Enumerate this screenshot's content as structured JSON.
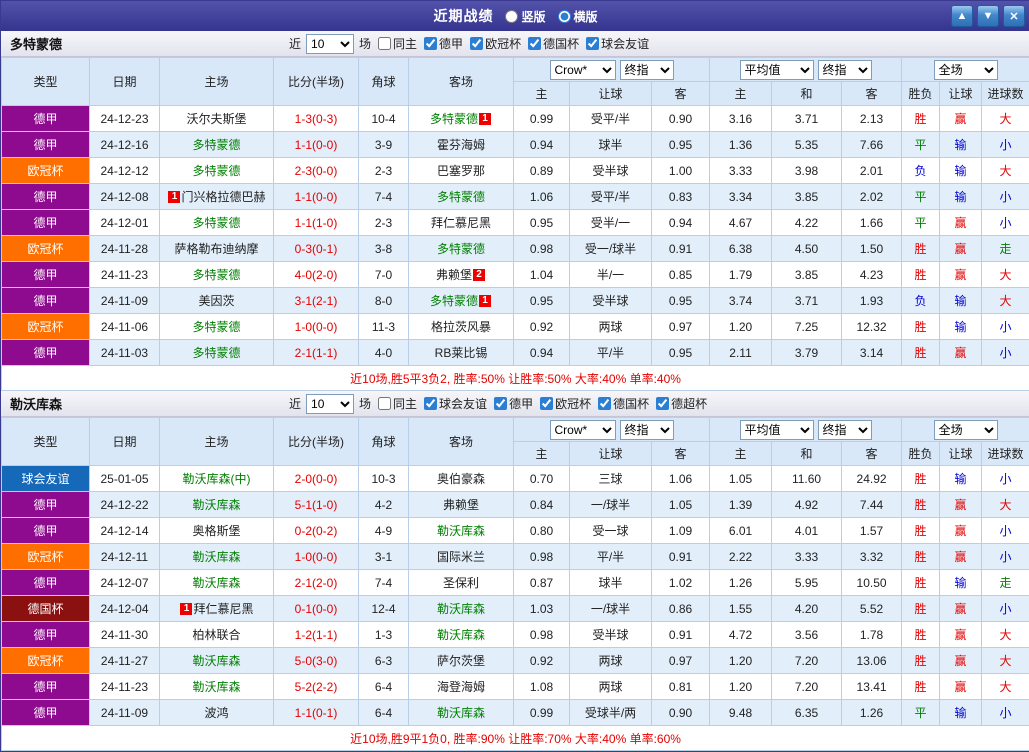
{
  "titlebar": {
    "title": "近期战绩",
    "radio_vertical": "竖版",
    "radio_horizontal": "横版",
    "vertical_selected": false,
    "horizontal_selected": true,
    "up_icon": "▲",
    "down_icon": "▼",
    "close_icon": "✕"
  },
  "colors": {
    "league": {
      "德甲": "#8e0a8e",
      "欧冠杯": "#ff6f00",
      "德国杯": "#8b1010",
      "球会友谊": "#1569b8"
    },
    "win": "#e60000",
    "draw": "#008000",
    "loss": "#0000d8",
    "team_highlight": "#008000"
  },
  "table_header": {
    "cols": [
      "类型",
      "日期",
      "主场",
      "比分(半场)",
      "角球",
      "客场"
    ],
    "sub_cols": [
      "主",
      "让球",
      "客",
      "主",
      "和",
      "客",
      "胜负",
      "让球",
      "进球数"
    ],
    "bookmaker_select": "Crow*",
    "final_index_select_1": "终指",
    "average_select": "平均值",
    "final_index_select_2": "终指",
    "scope_select": "全场"
  },
  "sections": [
    {
      "team": "多特蒙德",
      "filter": {
        "prefix": "近",
        "count": "10",
        "suffix": "场",
        "checkboxes": [
          {
            "label": "同主",
            "checked": false
          },
          {
            "label": "德甲",
            "checked": true
          },
          {
            "label": "欧冠杯",
            "checked": true
          },
          {
            "label": "德国杯",
            "checked": true
          },
          {
            "label": "球会友谊",
            "checked": true
          }
        ]
      },
      "rows": [
        {
          "league": "德甲",
          "date": "24-12-23",
          "home": {
            "name": "沃尔夫斯堡"
          },
          "score": "1-3(0-3)",
          "corner": "10-4",
          "away": {
            "name": "多特蒙德",
            "hl": true,
            "badge": "1",
            "pos": "after"
          },
          "odds": [
            "0.99",
            "受平/半",
            "0.90"
          ],
          "avg": [
            "3.16",
            "3.71",
            "2.13"
          ],
          "res": [
            [
              "胜",
              "r"
            ],
            [
              "赢",
              "r"
            ],
            [
              "大",
              "r"
            ]
          ]
        },
        {
          "league": "德甲",
          "date": "24-12-16",
          "home": {
            "name": "多特蒙德",
            "hl": true
          },
          "score": "1-1(0-0)",
          "corner": "3-9",
          "away": {
            "name": "霍芬海姆"
          },
          "odds": [
            "0.94",
            "球半",
            "0.95"
          ],
          "avg": [
            "1.36",
            "5.35",
            "7.66"
          ],
          "res": [
            [
              "平",
              "g"
            ],
            [
              "输",
              "b"
            ],
            [
              "小",
              "b"
            ]
          ]
        },
        {
          "league": "欧冠杯",
          "date": "24-12-12",
          "home": {
            "name": "多特蒙德",
            "hl": true
          },
          "score": "2-3(0-0)",
          "corner": "2-3",
          "away": {
            "name": "巴塞罗那"
          },
          "odds": [
            "0.89",
            "受半球",
            "1.00"
          ],
          "avg": [
            "3.33",
            "3.98",
            "2.01"
          ],
          "res": [
            [
              "负",
              "b"
            ],
            [
              "输",
              "b"
            ],
            [
              "大",
              "r"
            ]
          ]
        },
        {
          "league": "德甲",
          "date": "24-12-08",
          "home": {
            "name": "门兴格拉德巴赫",
            "badge": "1",
            "pos": "before"
          },
          "score": "1-1(0-0)",
          "corner": "7-4",
          "away": {
            "name": "多特蒙德",
            "hl": true
          },
          "odds": [
            "1.06",
            "受平/半",
            "0.83"
          ],
          "avg": [
            "3.34",
            "3.85",
            "2.02"
          ],
          "res": [
            [
              "平",
              "g"
            ],
            [
              "输",
              "b"
            ],
            [
              "小",
              "b"
            ]
          ]
        },
        {
          "league": "德甲",
          "date": "24-12-01",
          "home": {
            "name": "多特蒙德",
            "hl": true
          },
          "score": "1-1(1-0)",
          "corner": "2-3",
          "away": {
            "name": "拜仁慕尼黑"
          },
          "odds": [
            "0.95",
            "受半/一",
            "0.94"
          ],
          "avg": [
            "4.67",
            "4.22",
            "1.66"
          ],
          "res": [
            [
              "平",
              "g"
            ],
            [
              "赢",
              "r"
            ],
            [
              "小",
              "b"
            ]
          ]
        },
        {
          "league": "欧冠杯",
          "date": "24-11-28",
          "home": {
            "name": "萨格勒布迪纳摩"
          },
          "score": "0-3(0-1)",
          "corner": "3-8",
          "away": {
            "name": "多特蒙德",
            "hl": true
          },
          "odds": [
            "0.98",
            "受一/球半",
            "0.91"
          ],
          "avg": [
            "6.38",
            "4.50",
            "1.50"
          ],
          "res": [
            [
              "胜",
              "r"
            ],
            [
              "赢",
              "r"
            ],
            [
              "走",
              "g"
            ]
          ]
        },
        {
          "league": "德甲",
          "date": "24-11-23",
          "home": {
            "name": "多特蒙德",
            "hl": true
          },
          "score": "4-0(2-0)",
          "corner": "7-0",
          "away": {
            "name": "弗赖堡",
            "badge": "2",
            "pos": "after"
          },
          "odds": [
            "1.04",
            "半/一",
            "0.85"
          ],
          "avg": [
            "1.79",
            "3.85",
            "4.23"
          ],
          "res": [
            [
              "胜",
              "r"
            ],
            [
              "赢",
              "r"
            ],
            [
              "大",
              "r"
            ]
          ]
        },
        {
          "league": "德甲",
          "date": "24-11-09",
          "home": {
            "name": "美因茨"
          },
          "score": "3-1(2-1)",
          "corner": "8-0",
          "away": {
            "name": "多特蒙德",
            "hl": true,
            "badge": "1",
            "pos": "after"
          },
          "odds": [
            "0.95",
            "受半球",
            "0.95"
          ],
          "avg": [
            "3.74",
            "3.71",
            "1.93"
          ],
          "res": [
            [
              "负",
              "b"
            ],
            [
              "输",
              "b"
            ],
            [
              "大",
              "r"
            ]
          ]
        },
        {
          "league": "欧冠杯",
          "date": "24-11-06",
          "home": {
            "name": "多特蒙德",
            "hl": true
          },
          "score": "1-0(0-0)",
          "corner": "11-3",
          "away": {
            "name": "格拉茨风暴"
          },
          "odds": [
            "0.92",
            "两球",
            "0.97"
          ],
          "avg": [
            "1.20",
            "7.25",
            "12.32"
          ],
          "res": [
            [
              "胜",
              "r"
            ],
            [
              "输",
              "b"
            ],
            [
              "小",
              "b"
            ]
          ]
        },
        {
          "league": "德甲",
          "date": "24-11-03",
          "home": {
            "name": "多特蒙德",
            "hl": true
          },
          "score": "2-1(1-1)",
          "corner": "4-0",
          "away": {
            "name": "RB莱比锡"
          },
          "odds": [
            "0.94",
            "平/半",
            "0.95"
          ],
          "avg": [
            "2.11",
            "3.79",
            "3.14"
          ],
          "res": [
            [
              "胜",
              "r"
            ],
            [
              "赢",
              "r"
            ],
            [
              "小",
              "b"
            ]
          ]
        }
      ],
      "summary": "近10场,胜5平3负2, 胜率:50%  让胜率:50%  大率:40%  单率:40%"
    },
    {
      "team": "勒沃库森",
      "filter": {
        "prefix": "近",
        "count": "10",
        "suffix": "场",
        "checkboxes": [
          {
            "label": "同主",
            "checked": false
          },
          {
            "label": "球会友谊",
            "checked": true
          },
          {
            "label": "德甲",
            "checked": true
          },
          {
            "label": "欧冠杯",
            "checked": true
          },
          {
            "label": "德国杯",
            "checked": true
          },
          {
            "label": "德超杯",
            "checked": true
          }
        ]
      },
      "rows": [
        {
          "league": "球会友谊",
          "date": "25-01-05",
          "home": {
            "name": "勒沃库森(中)",
            "hl": true
          },
          "score": "2-0(0-0)",
          "corner": "10-3",
          "away": {
            "name": "奥伯豪森"
          },
          "odds": [
            "0.70",
            "三球",
            "1.06"
          ],
          "avg": [
            "1.05",
            "11.60",
            "24.92"
          ],
          "res": [
            [
              "胜",
              "r"
            ],
            [
              "输",
              "b"
            ],
            [
              "小",
              "b"
            ]
          ]
        },
        {
          "league": "德甲",
          "date": "24-12-22",
          "home": {
            "name": "勒沃库森",
            "hl": true
          },
          "score": "5-1(1-0)",
          "corner": "4-2",
          "away": {
            "name": "弗赖堡"
          },
          "odds": [
            "0.84",
            "一/球半",
            "1.05"
          ],
          "avg": [
            "1.39",
            "4.92",
            "7.44"
          ],
          "res": [
            [
              "胜",
              "r"
            ],
            [
              "赢",
              "r"
            ],
            [
              "大",
              "r"
            ]
          ]
        },
        {
          "league": "德甲",
          "date": "24-12-14",
          "home": {
            "name": "奥格斯堡"
          },
          "score": "0-2(0-2)",
          "corner": "4-9",
          "away": {
            "name": "勒沃库森",
            "hl": true
          },
          "odds": [
            "0.80",
            "受一球",
            "1.09"
          ],
          "avg": [
            "6.01",
            "4.01",
            "1.57"
          ],
          "res": [
            [
              "胜",
              "r"
            ],
            [
              "赢",
              "r"
            ],
            [
              "小",
              "b"
            ]
          ]
        },
        {
          "league": "欧冠杯",
          "date": "24-12-11",
          "home": {
            "name": "勒沃库森",
            "hl": true
          },
          "score": "1-0(0-0)",
          "corner": "3-1",
          "away": {
            "name": "国际米兰"
          },
          "odds": [
            "0.98",
            "平/半",
            "0.91"
          ],
          "avg": [
            "2.22",
            "3.33",
            "3.32"
          ],
          "res": [
            [
              "胜",
              "r"
            ],
            [
              "赢",
              "r"
            ],
            [
              "小",
              "b"
            ]
          ]
        },
        {
          "league": "德甲",
          "date": "24-12-07",
          "home": {
            "name": "勒沃库森",
            "hl": true
          },
          "score": "2-1(2-0)",
          "corner": "7-4",
          "away": {
            "name": "圣保利"
          },
          "odds": [
            "0.87",
            "球半",
            "1.02"
          ],
          "avg": [
            "1.26",
            "5.95",
            "10.50"
          ],
          "res": [
            [
              "胜",
              "r"
            ],
            [
              "输",
              "b"
            ],
            [
              "走",
              "g"
            ]
          ]
        },
        {
          "league": "德国杯",
          "date": "24-12-04",
          "home": {
            "name": "拜仁慕尼黑",
            "badge": "1",
            "pos": "before"
          },
          "score": "0-1(0-0)",
          "corner": "12-4",
          "away": {
            "name": "勒沃库森",
            "hl": true
          },
          "odds": [
            "1.03",
            "一/球半",
            "0.86"
          ],
          "avg": [
            "1.55",
            "4.20",
            "5.52"
          ],
          "res": [
            [
              "胜",
              "r"
            ],
            [
              "赢",
              "r"
            ],
            [
              "小",
              "b"
            ]
          ]
        },
        {
          "league": "德甲",
          "date": "24-11-30",
          "home": {
            "name": "柏林联合"
          },
          "score": "1-2(1-1)",
          "corner": "1-3",
          "away": {
            "name": "勒沃库森",
            "hl": true
          },
          "odds": [
            "0.98",
            "受半球",
            "0.91"
          ],
          "avg": [
            "4.72",
            "3.56",
            "1.78"
          ],
          "res": [
            [
              "胜",
              "r"
            ],
            [
              "赢",
              "r"
            ],
            [
              "大",
              "r"
            ]
          ]
        },
        {
          "league": "欧冠杯",
          "date": "24-11-27",
          "home": {
            "name": "勒沃库森",
            "hl": true
          },
          "score": "5-0(3-0)",
          "corner": "6-3",
          "away": {
            "name": "萨尔茨堡"
          },
          "odds": [
            "0.92",
            "两球",
            "0.97"
          ],
          "avg": [
            "1.20",
            "7.20",
            "13.06"
          ],
          "res": [
            [
              "胜",
              "r"
            ],
            [
              "赢",
              "r"
            ],
            [
              "大",
              "r"
            ]
          ]
        },
        {
          "league": "德甲",
          "date": "24-11-23",
          "home": {
            "name": "勒沃库森",
            "hl": true
          },
          "score": "5-2(2-2)",
          "corner": "6-4",
          "away": {
            "name": "海登海姆"
          },
          "odds": [
            "1.08",
            "两球",
            "0.81"
          ],
          "avg": [
            "1.20",
            "7.20",
            "13.41"
          ],
          "res": [
            [
              "胜",
              "r"
            ],
            [
              "赢",
              "r"
            ],
            [
              "大",
              "r"
            ]
          ]
        },
        {
          "league": "德甲",
          "date": "24-11-09",
          "home": {
            "name": "波鸿"
          },
          "score": "1-1(0-1)",
          "corner": "6-4",
          "away": {
            "name": "勒沃库森",
            "hl": true
          },
          "odds": [
            "0.99",
            "受球半/两",
            "0.90"
          ],
          "avg": [
            "9.48",
            "6.35",
            "1.26"
          ],
          "res": [
            [
              "平",
              "g"
            ],
            [
              "输",
              "b"
            ],
            [
              "小",
              "b"
            ]
          ]
        }
      ],
      "summary": "近10场,胜9平1负0, 胜率:90%  让胜率:70%  大率:40%  单率:60%"
    }
  ]
}
